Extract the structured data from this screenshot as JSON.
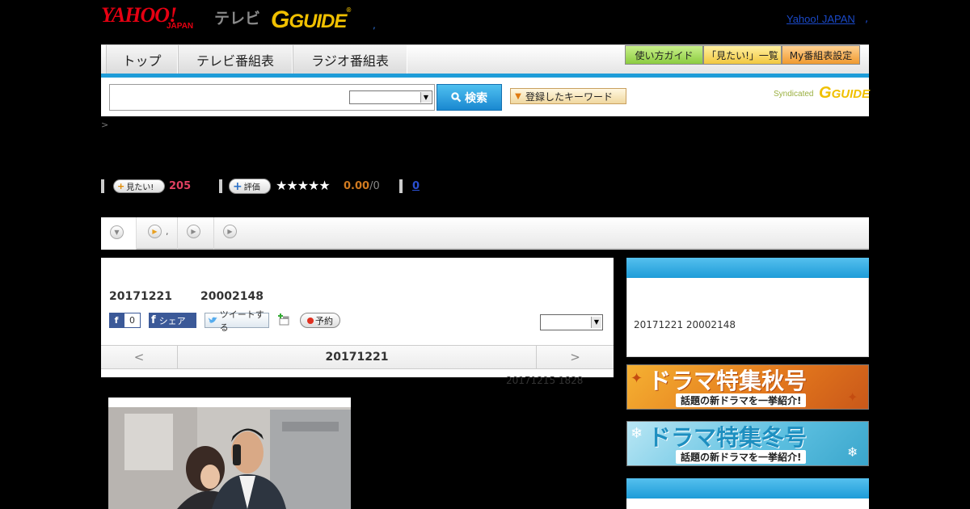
{
  "header": {
    "logo_yahoo": "YAHOO!",
    "logo_japan": "JAPAN",
    "logo_tv": "テレビ",
    "logo_gguide": "GUIDE",
    "dot": ",",
    "yahoo_japan_link": "Yahoo! JAPAN",
    "yahoo_japan_dot": ","
  },
  "nav": {
    "tabs": [
      {
        "label": "トップ"
      },
      {
        "label": "テレビ番組表"
      },
      {
        "label": "ラジオ番組表"
      }
    ],
    "right_buttons": [
      {
        "label": "使い方ガイド",
        "color": "#9fd65a"
      },
      {
        "label": "「見たい!」一覧",
        "color": "#f7d257"
      },
      {
        "label": "My番組表設定",
        "color": "#f2a64a"
      }
    ]
  },
  "search": {
    "input_value": "",
    "button_label": "検索",
    "keyword_button": "登録したキーワード",
    "syndicated": "Syndicated",
    "syndicated_logo": "GUIDE"
  },
  "breadcrumb": ">",
  "stats": {
    "mitai_label": "見たい!",
    "mitai_count": "205",
    "hyouka_label": "評価",
    "stars": "★★★★★",
    "rating": "0.00",
    "rating_count": "/0",
    "comments": "0"
  },
  "subnav": {
    "item2_text": ","
  },
  "program": {
    "date": "20171221",
    "time": "20002148",
    "fb_count": "0",
    "share_label": "シェア",
    "tweet_label": "ツイートする",
    "reserve_label": "予約",
    "day_prev": "<",
    "day_current": "20171221",
    "day_next": ">",
    "updated": "20171215  1828"
  },
  "sidebar": {
    "box1_text": "20171221  20002148",
    "banner_autumn": {
      "title": "ドラマ特集秋号",
      "sub": "話題の新ドラマを一挙紹介!",
      "color": "#e2761c"
    },
    "banner_winter": {
      "title": "ドラマ特集冬号",
      "sub": "話題の新ドラマを一挙紹介!",
      "color": "#5cbfe0"
    }
  },
  "colors": {
    "accent": "#1e9cd8",
    "yahoo_red": "#e60012",
    "gguide_yellow": "#f0c000"
  }
}
